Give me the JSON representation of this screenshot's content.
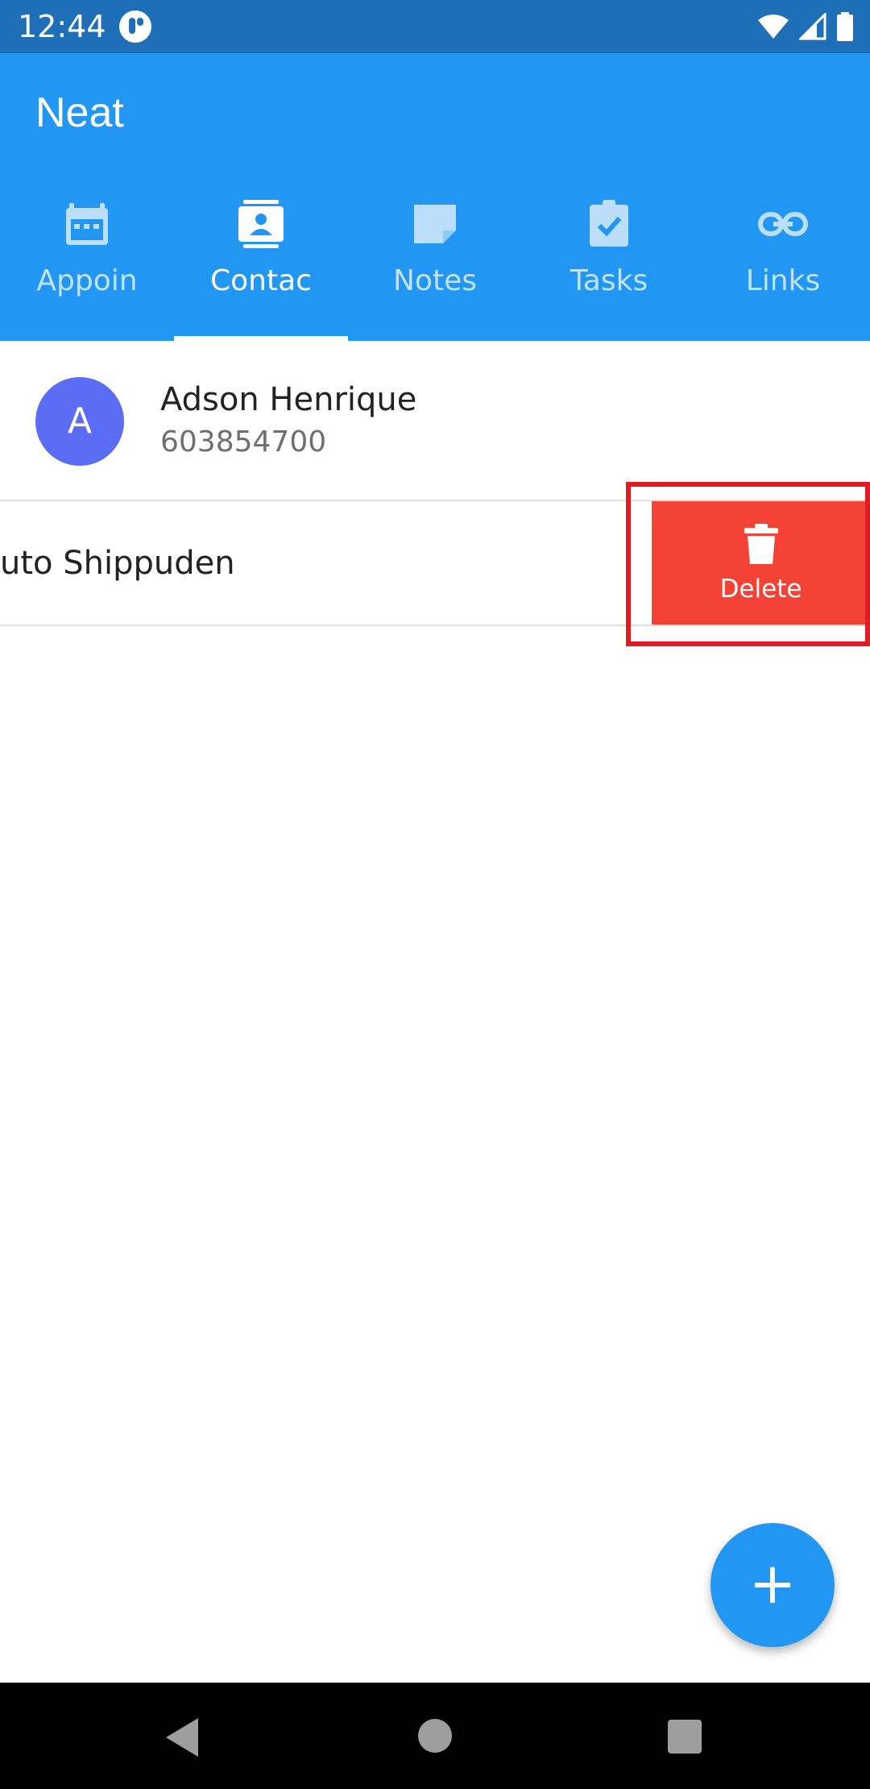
{
  "status_bar": {
    "time": "12:44",
    "icons": [
      "app-notification-icon",
      "wifi-icon",
      "signal-icon",
      "battery-icon"
    ]
  },
  "app": {
    "title": "Neat",
    "primary_color": "#2196f3",
    "tabs": [
      {
        "label": "Appoin",
        "icon": "calendar-icon",
        "active": false
      },
      {
        "label": "Contac",
        "icon": "contact-card-icon",
        "active": true
      },
      {
        "label": "Notes",
        "icon": "note-icon",
        "active": false
      },
      {
        "label": "Tasks",
        "icon": "clipboard-check-icon",
        "active": false
      },
      {
        "label": "Links",
        "icon": "link-icon",
        "active": false
      }
    ]
  },
  "contacts": [
    {
      "initial": "A",
      "name": "Adson Henrique",
      "phone": "603854700",
      "avatar_color": "#5b6cf5"
    },
    {
      "name": "uto Shippuden",
      "swiped": true
    }
  ],
  "swipe_action": {
    "label": "Delete",
    "icon": "trash-icon",
    "color": "#f44336"
  },
  "fab": {
    "label": "+",
    "icon": "plus-icon"
  },
  "nav_bar": {
    "icons": [
      "back-icon",
      "home-icon",
      "recents-icon"
    ]
  }
}
